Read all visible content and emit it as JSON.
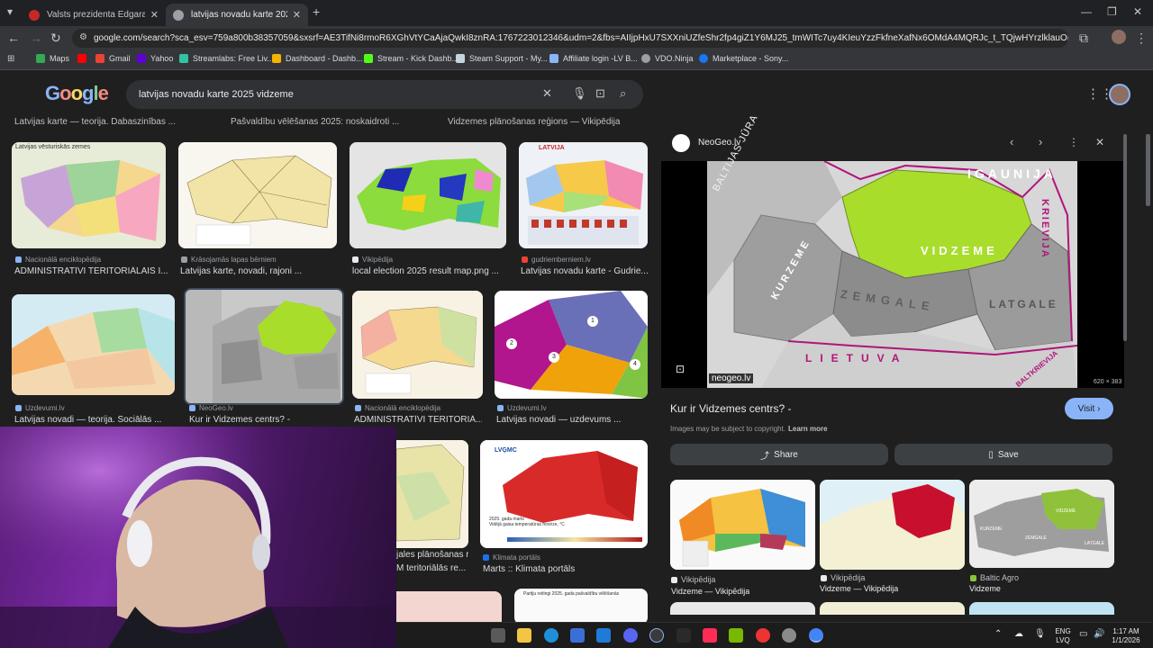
{
  "browser": {
    "tabs": [
      {
        "title": "Valsts prezidenta Edgara Rinkē..."
      },
      {
        "title": "latvijas novadu karte 2025 vidz..."
      }
    ],
    "new_tab": "+",
    "url": "google.com/search?sca_esv=759a800b38357059&sxsrf=AE3TifNi8rmoR6XGhVtYCaAjaQwkI8znRA:1767223012346&udm=2&fbs=AIIjpHxU7SXXniUZfeShr2fp4giZ1Y6MJ25_tmWITc7uy4KIeuYzzFkfneXafNx6OMdA4MQRJc_t_TQjwHYrzlklauOKiWCnruNfHTRm...",
    "bookmarks": [
      {
        "label": "Maps",
        "color": "#34a853"
      },
      {
        "label": "",
        "color": "#ff0000"
      },
      {
        "label": "Gmail",
        "color": "#ea4335"
      },
      {
        "label": "Yahoo",
        "color": "#6001d2"
      },
      {
        "label": "Streamlabs: Free Liv...",
        "color": "#31c3a2"
      },
      {
        "label": "Dashboard - Dashb...",
        "color": "#f4b400"
      },
      {
        "label": "Stream - Kick Dashb...",
        "color": "#53fc18"
      },
      {
        "label": "Steam Support - My...",
        "color": "#c6d4df"
      },
      {
        "label": "Affiliate login -LV B...",
        "color": "#8ab4f8"
      },
      {
        "label": "VDO.Ninja",
        "color": "#9aa0a6"
      },
      {
        "label": "Marketplace - Sony...",
        "color": "#1877f2"
      }
    ]
  },
  "google": {
    "logo": "Google",
    "query": "latvijas novadu karte 2025 vidzeme",
    "top_captions": [
      "Latvijas karte — teorija. Dabaszinības ...",
      "Pašvaldību vēlēšanas 2025: noskaidroti ...",
      "Vidzemes plānošanas reģions — Vikipēdija"
    ],
    "results": [
      {
        "source": "Nacionālā enciklopēdija",
        "title": "ADMINISTRATĪVI TERITORIĀLAIS I...",
        "thumb_label": "Latvijas vēsturiskās zemes",
        "src_color": "#8ab4f8"
      },
      {
        "source": "Krāsojamās lapas bērniem",
        "title": "Latvijas karte, novadi, rajoni ...",
        "thumb_label": "",
        "src_color": "#9aa0a6"
      },
      {
        "source": "Vikipēdija",
        "title": "local election 2025 result map.png ...",
        "thumb_label": "",
        "src_color": "#e8eaed"
      },
      {
        "source": "gudriemberniem.lv",
        "title": "Latvijas novadu karte - Gudrie...",
        "thumb_label": "LATVIJA",
        "src_color": "#ea4335"
      },
      {
        "source": "Uzdevumi.lv",
        "title": "Latvijas novadi — teorija. Sociālās ...",
        "thumb_label": "",
        "src_color": "#8ab4f8"
      },
      {
        "source": "NeoGeo.lv",
        "title": "Kur ir Vidzemes centrs? -",
        "thumb_label": "",
        "src_color": "#8ab4f8"
      },
      {
        "source": "Nacionālā enciklopēdija",
        "title": "ADMINISTRATĪVI TERITORIĀ...",
        "thumb_label": "",
        "src_color": "#8ab4f8"
      },
      {
        "source": "Uzdevumi.lv",
        "title": "Latvijas novadi — uzdevums ...",
        "thumb_label": "",
        "src_color": "#8ab4f8"
      },
      {
        "source": "",
        "title": "jales plānošanas r...",
        "thumb_label": "",
        "src_color": "#9aa0a6"
      },
      {
        "source": "",
        "title": "M teritoriālās re...",
        "thumb_label": "",
        "src_color": "#9aa0a6"
      },
      {
        "source": "Klimata portāls",
        "title": "Marts :: Klimata portāls",
        "thumb_label": "LVĢMC",
        "src_color": "#1a73e8"
      }
    ],
    "numbered_regions": [
      "1",
      "2",
      "3",
      "4"
    ],
    "climate_caption": "2025. gada marts\nVidējā gaisa temperatūras novirze, °C",
    "bottom_card_label": "Partiju reitingi 2025. gada pašvaldību vēlēšanās"
  },
  "panel": {
    "site": "NeoGeo.lv",
    "map_labels": {
      "sea": "BALTIJAS JŪRA",
      "estonia": "IGAUNIJA",
      "russia": "KRIEVIJA",
      "vidzeme": "VIDZEME",
      "kurzeme": "KURZEME",
      "zemgale": "ZEMGALE",
      "latgale": "LATGALE",
      "lithuania": "LIETUVA",
      "belarus": "BALTKRIEVIJA"
    },
    "watermark": "neogeo.lv",
    "dimensions": "620 × 383",
    "title": "Kur ir Vidzemes centrs? -",
    "visit": "Visit",
    "copyright": "Images may be subject to copyright.",
    "learn_more": "Learn more",
    "share": "Share",
    "save": "Save",
    "related": [
      {
        "source": "Vikipēdija",
        "title": "Vidzeme — Vikipēdija"
      },
      {
        "source": "Vikipēdija",
        "title": "Vidzeme — Vikipēdija"
      },
      {
        "source": "Baltic Agro",
        "title": "Vidzeme"
      }
    ],
    "related_labels": {
      "vidzeme": "VIDZEME",
      "kurzeme": "KURZEME",
      "zemgale": "ZEMGALE",
      "latgale": "LATGALE"
    }
  },
  "taskbar": {
    "lang1": "ENG",
    "lang2": "LVQ",
    "time": "1:17 AM",
    "date": "1/1/2026"
  }
}
